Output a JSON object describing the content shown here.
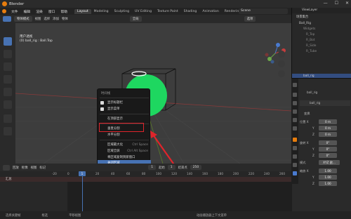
{
  "window": {
    "title": "Blender",
    "controls": [
      "—",
      "☐",
      "✕"
    ]
  },
  "menubar": {
    "items": [
      "文件",
      "编辑",
      "渲染",
      "窗口",
      "帮助"
    ],
    "tabs": [
      "Layout",
      "Modeling",
      "Sculpting",
      "UV Editing",
      "Texture Paint",
      "Shading",
      "Animation",
      "Rendering"
    ],
    "active_tab": "Layout",
    "scene": "Scene",
    "view_layer": "ViewLayer"
  },
  "viewport_header": {
    "mode": "物体模式",
    "menus": [
      "视图",
      "选择",
      "添加",
      "物体"
    ],
    "orientation": "全局",
    "options": "选项"
  },
  "viewport_info": {
    "line1": "用户透视",
    "line2": "(0) ball_rig : Ball.Top"
  },
  "context_menu": {
    "title": "时间线",
    "items": [
      {
        "label": "显示标题栏",
        "checked": true
      },
      {
        "label": "显示菜单",
        "checked": true
      },
      {
        "label": "在顶部显示",
        "checked": false
      },
      {
        "label": "垂直分割",
        "checked": false,
        "boxed": true
      },
      {
        "label": "水平分割",
        "checked": false
      },
      {
        "label": "区域最大化",
        "shortcut": "Ctrl Space"
      },
      {
        "label": "区域全屏",
        "shortcut": "Ctrl Alt Space"
      },
      {
        "label": "将区域复制到新窗口"
      },
      {
        "label": "关闭区域",
        "highlighted": true
      }
    ],
    "tooltip": "关闭所选区域"
  },
  "outliner": {
    "header": "场景集合",
    "rows": [
      "Ball_Rig",
      "Widgets",
      "R_Top",
      "R_Bot",
      "R_Side",
      "R_Tube",
      "ball_rig"
    ]
  },
  "properties": {
    "object_name": "ball_rig",
    "data_name": "ball_rig",
    "section": "变换",
    "location_label": "位置 X",
    "location": [
      "0 m",
      "0 m",
      "0 m"
    ],
    "rotation_label": "旋转 X",
    "rotation": [
      "0°",
      "0°",
      "0°"
    ],
    "mode_label": "模式",
    "mode": "XYZ 欧...",
    "scale_label": "缩放 X",
    "scale": [
      "1.00",
      "1.00",
      "1.00"
    ],
    "axis_labels": [
      "Y",
      "Z"
    ]
  },
  "timeline": {
    "menus": [
      "回放",
      "抠像",
      "视图",
      "标记"
    ],
    "current_frame": "1",
    "start_label": "起始",
    "start": "1",
    "end_label": "结束点",
    "end": "250",
    "ticks": [
      "-20",
      "0",
      "20",
      "40",
      "60",
      "80",
      "100",
      "120",
      "140",
      "160",
      "180",
      "200",
      "220",
      "240",
      "260"
    ],
    "summary": "汇总"
  },
  "statusbar": {
    "left": "选择关键帧",
    "middle": "框选",
    "right": "平移视图",
    "extra": "动画播放器上下文菜单"
  },
  "colors": {
    "accent": "#4772b3",
    "highlight_box": "#e0242b",
    "sphere": "#1ed760",
    "brand": "#e87d0d"
  }
}
